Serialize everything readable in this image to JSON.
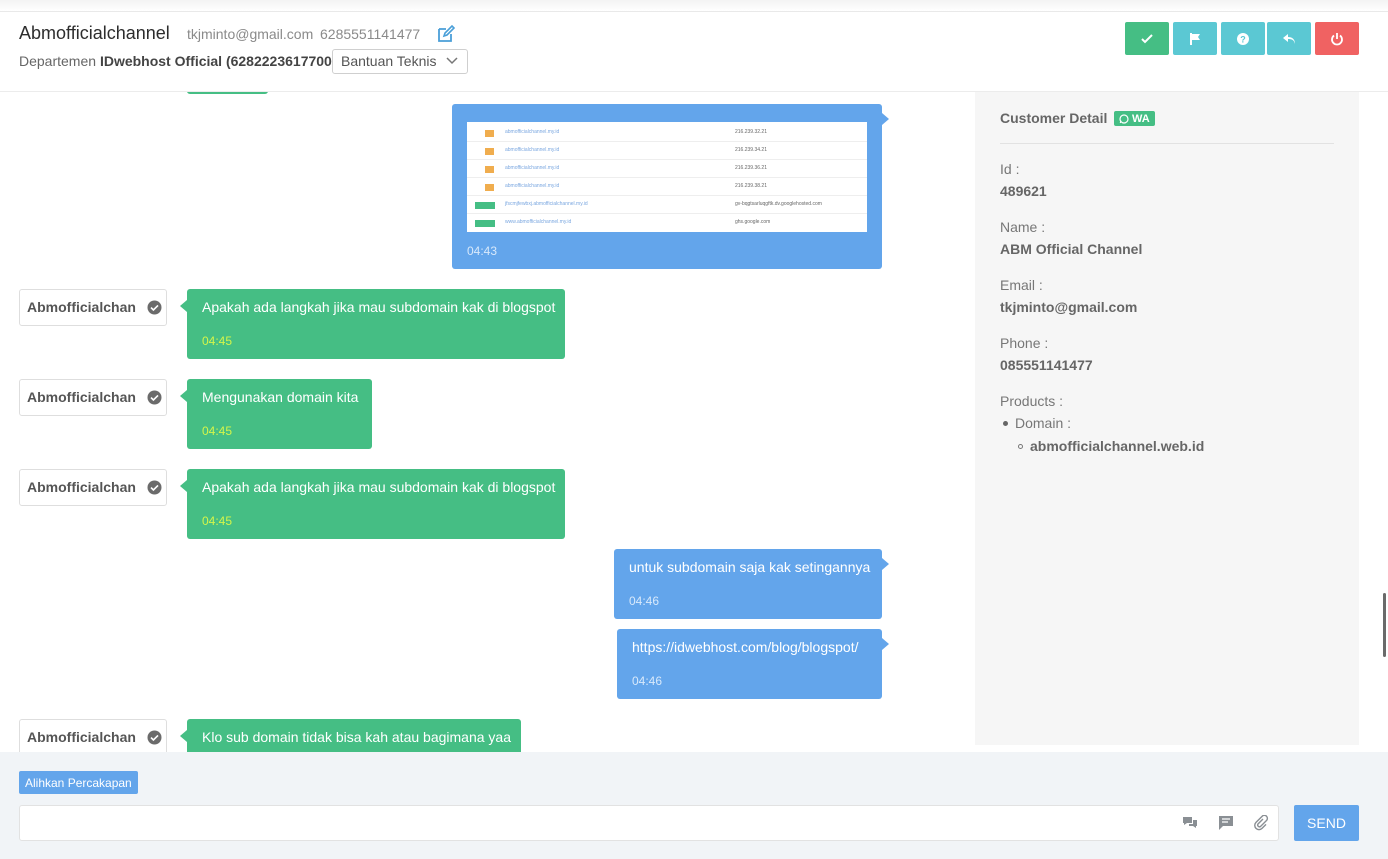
{
  "header": {
    "title": "Abmofficialchannel",
    "email": "tkjminto@gmail.com",
    "phone": "6285551141477",
    "dept_label": "Departemen",
    "dept_name": "IDwebhost Official (6282223617700)",
    "dept_select": "Bantuan Teknis",
    "buttons": [
      {
        "icon": "check-icon",
        "color": "#45be84"
      },
      {
        "icon": "flag-icon",
        "color": "#5bc8d3"
      },
      {
        "icon": "question-icon",
        "color": "#5bc8d3"
      },
      {
        "icon": "reply-icon",
        "color": "#5bc8d3"
      },
      {
        "icon": "power-icon",
        "color": "#f06262"
      }
    ]
  },
  "chat": {
    "image_message": {
      "time": "04:43",
      "rows": [
        {
          "type": "A",
          "name": "abmofficialchannel.my.id",
          "value": "216.239.32.21"
        },
        {
          "type": "A",
          "name": "abmofficialchannel.my.id",
          "value": "216.239.34.21"
        },
        {
          "type": "A",
          "name": "abmofficialchannel.my.id",
          "value": "216.239.36.21"
        },
        {
          "type": "A",
          "name": "abmofficialchannel.my.id",
          "value": "216.239.38.21"
        },
        {
          "type": "CNAME",
          "name": "jfscmjfewbxj.abmofficialchannel.my.id",
          "value": "gv-bqgtsarluqgftk.dv.googlehosted.com"
        },
        {
          "type": "CNAME",
          "name": "www.abmofficialchannel.my.id",
          "value": "ghs.google.com"
        }
      ]
    },
    "messages": [
      {
        "sender": "Abmofficialchan",
        "text": "Apakah ada langkah jika mau subdomain kak di blogspot",
        "time": "04:45"
      },
      {
        "sender": "Abmofficialchan",
        "text": "Mengunakan domain kita",
        "time": "04:45"
      },
      {
        "sender": "Abmofficialchan",
        "text": "Apakah ada langkah jika mau subdomain kak di blogspot",
        "time": "04:45"
      },
      {
        "text": "untuk subdomain saja kak setingannya",
        "time": "04:46"
      },
      {
        "text": "https://idwebhost.com/blog/blogspot/",
        "time": "04:46"
      },
      {
        "sender": "Abmofficialchan",
        "text": "Klo sub domain tidak bisa kah atau bagimana yaa",
        "time": ""
      }
    ]
  },
  "detail": {
    "title": "Customer Detail",
    "badge": "WA",
    "id_label": "Id :",
    "id_value": "489621",
    "name_label": "Name :",
    "name_value": "ABM Official Channel",
    "email_label": "Email :",
    "email_value": "tkjminto@gmail.com",
    "phone_label": "Phone :",
    "phone_value": "085551141477",
    "products_label": "Products :",
    "product_type": "Domain :",
    "product_value": "abmofficialchannel.web.id"
  },
  "footer": {
    "transfer_label": "Alihkan Percakapan",
    "input_value": "",
    "input_placeholder": "",
    "send_label": "SEND"
  },
  "colors": {
    "incoming": "#45be84",
    "outgoing": "#63a5eb"
  }
}
